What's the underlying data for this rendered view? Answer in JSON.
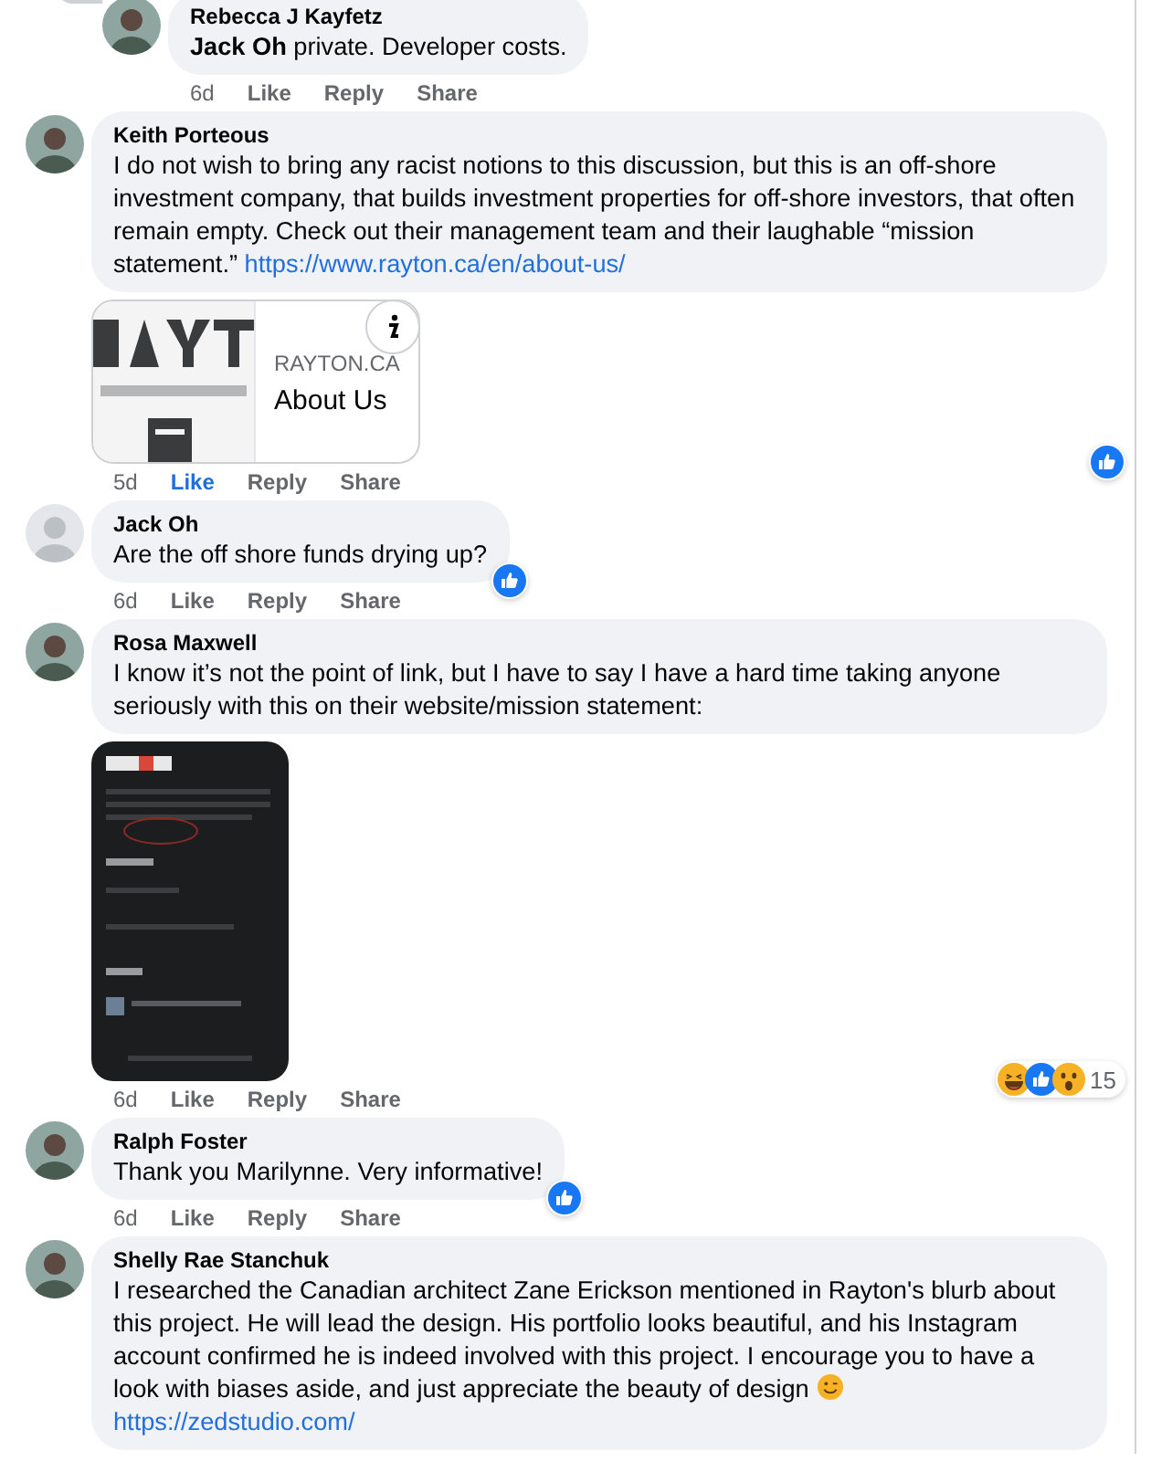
{
  "comments": [
    {
      "name": "Rebecca J Kayfetz",
      "reply": true,
      "text": "**Jack Oh** private. Developer costs.",
      "time": "6d",
      "actions": [
        "Like",
        "Reply",
        "Share"
      ],
      "liked": false
    },
    {
      "name": "Keith Porteous",
      "reply": false,
      "text": "I do not wish to bring any racist notions to this discussion, but this is an off-shore investment company, that builds investment properties for off-shore investors, that often remain empty. Check out their management team and their laughable “mission statement.”",
      "link": "https://www.rayton.ca/en/about-us/",
      "attachment": {
        "kind": "link",
        "domain": "RAYTON.CA",
        "title": "About Us"
      },
      "time": "5d",
      "actions": [
        "Like",
        "Reply",
        "Share"
      ],
      "liked": true,
      "reactions": {
        "items": [
          {
            "kind": "like"
          }
        ]
      }
    },
    {
      "name": "Jack Oh",
      "reply": false,
      "default_avatar": true,
      "text": "Are the off shore funds drying up?",
      "time": "6d",
      "actions": [
        "Like",
        "Reply",
        "Share"
      ],
      "liked": false,
      "reactions": {
        "items": [
          {
            "kind": "like"
          }
        ]
      }
    },
    {
      "name": "Rosa Maxwell",
      "reply": false,
      "text": "I know it’s not the point of link, but I have to say I have a hard time taking anyone seriously with this on their website/mission statement:",
      "time": "6d",
      "actions": [
        "Like",
        "Reply",
        "Share"
      ],
      "liked": false,
      "reactions": {
        "items": [
          {
            "kind": "laugh"
          },
          {
            "kind": "like"
          },
          {
            "kind": "wow"
          }
        ],
        "count": "15"
      }
    },
    {
      "name": "Ralph Foster",
      "reply": false,
      "text": "Thank you Marilynne. Very informative!",
      "time": "6d",
      "actions": [
        "Like",
        "Reply",
        "Share"
      ],
      "liked": false,
      "reactions": {
        "items": [
          {
            "kind": "like"
          }
        ]
      }
    },
    {
      "name": "Shelly Rae Stanchuk",
      "reply": false,
      "text": "I researched the Canadian architect Zane Erickson mentioned in Rayton's blurb about this project. He will lead the design. His portfolio looks beautiful, and his Instagram account confirmed he is indeed involved with this project. I encourage you to have a look with biases aside, and just appreciate the beauty of design",
      "emoji": {
        "kind": "wink"
      },
      "link": "https://zedstudio.com/"
    }
  ]
}
